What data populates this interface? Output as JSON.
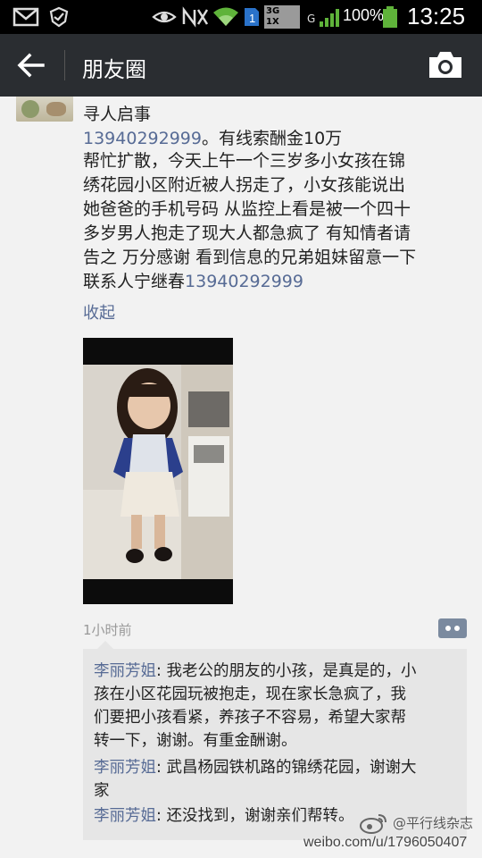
{
  "status_bar": {
    "network_badge": "3G\n1X",
    "network_type": "G",
    "battery_percent": "100%",
    "time": "13:25",
    "icons": [
      "mail-icon",
      "shield-icon",
      "eye-icon",
      "nfc-icon",
      "wifi-icon",
      "sim-icon",
      "signal-icon",
      "battery-icon"
    ]
  },
  "header": {
    "title": "朋友圈",
    "back_icon": "arrow-left-icon",
    "camera_icon": "camera-icon"
  },
  "post": {
    "title": "寻人启事",
    "phone": "13940292999",
    "phone_suffix": "。有线索酬金10万",
    "body_lines": [
      "帮忙扩散，今天上午一个三岁多小女孩在锦",
      "绣花园小区附近被人拐走了，小女孩能说出",
      "她爸爸的手机号码 从监控上看是被一个四十",
      "多岁男人抱走了现大人都急疯了 有知情者请",
      "告之 万分感谢 看到信息的兄弟姐妹留意一下"
    ],
    "contact_prefix": "联系人宁继春",
    "contact_phone": "13940292999",
    "collapse_label": "收起",
    "time_ago": "1小时前"
  },
  "comments": [
    {
      "name": "李丽芳姐",
      "lines": [
        ": 我老公的朋友的小孩，是真是的，小",
        "孩在小区花园玩被抱走，现在家长急疯了，我",
        "们要把小孩看紧，养孩子不容易，希望大家帮",
        "转一下，谢谢。有重金酬谢。"
      ]
    },
    {
      "name": "李丽芳姐",
      "lines": [
        ": 武昌杨园铁机路的锦绣花园，谢谢大",
        "家"
      ]
    },
    {
      "name": "李丽芳姐",
      "lines": [
        ": 还没找到，谢谢亲们帮转。"
      ]
    }
  ],
  "watermark": {
    "handle": "@平行线杂志",
    "url": "weibo.com/u/1796050407"
  }
}
